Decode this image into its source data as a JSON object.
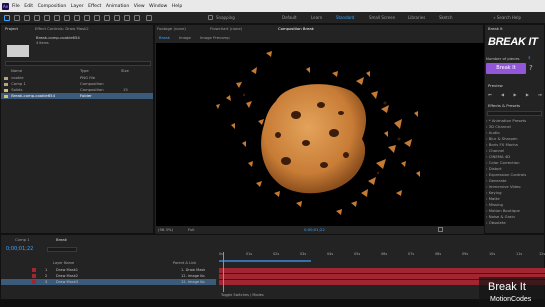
{
  "menubar": {
    "items": [
      "File",
      "Edit",
      "Composition",
      "Layer",
      "Effect",
      "Animation",
      "View",
      "Window",
      "Help"
    ]
  },
  "toolbar": {
    "snapping": "Snapping",
    "workspaces": [
      "Default",
      "Learn",
      "Standard",
      "Small Screen",
      "Libraries",
      "Sketch"
    ],
    "search_help": "Search Help"
  },
  "project": {
    "tab": "Project",
    "tab_effect_controls": "Effect Controls: Draw Mask2",
    "selected_name": "Break-comp-cookie654",
    "selected_info": "4 items",
    "headers": [
      "Name",
      "Type",
      "Size"
    ],
    "items": [
      {
        "name": "cookie",
        "type": "PNG file",
        "size": "",
        "color": "#b8a37a"
      },
      {
        "name": "Comp 1",
        "type": "Composition",
        "size": "",
        "color": "#b8a37a"
      },
      {
        "name": "Solids",
        "type": "Composition",
        "size": "15",
        "color": "#d6c06f"
      },
      {
        "name": "Break-comp-cookie654",
        "type": "Folder",
        "size": "",
        "color": "#d6c06f"
      }
    ]
  },
  "viewer": {
    "tab_footage": "Footage (none)",
    "tab_composition": "Composition Break",
    "tab_flowchart": "Flowchart (none)",
    "sub_tabs": [
      "Break",
      "Image",
      "Image Precomp"
    ],
    "zoom": "(56.3%)",
    "quality": "Full",
    "timecode": "0;00;01;22"
  },
  "break_it": {
    "panel_title": "Break It",
    "logo": "BREAK IT",
    "pieces_label": "Number of pieces",
    "pieces_value": "3",
    "button_label": "Break It",
    "help_glyph": "?"
  },
  "preview": {
    "title": "Preview"
  },
  "effects": {
    "title": "Effects & Presets",
    "items": [
      "* Animation Presets",
      "3D Channel",
      "Audio",
      "Blur & Sharpen",
      "Boris FX Mocha",
      "Channel",
      "CINEMA 4D",
      "Color Correction",
      "Distort",
      "Expression Controls",
      "Generate",
      "Immersive Video",
      "Keying",
      "Matte",
      "Missing",
      "Motion Boutique",
      "Noise & Grain",
      "Obsolete"
    ]
  },
  "timeline": {
    "tabs": [
      "Comp 1",
      "Break"
    ],
    "timecode": "0;00;01;22",
    "col_headers": [
      "Layer Name",
      "Parent & Link"
    ],
    "layers": [
      {
        "num": "1",
        "name": "Draw Mask1",
        "parent": "1. Draw Mask"
      },
      {
        "num": "2",
        "name": "Draw Mask2",
        "parent": "12. Image Ko"
      },
      {
        "num": "3",
        "name": "Draw Mask3",
        "parent": "12. Image Ko"
      }
    ],
    "ruler": [
      "0s",
      "01s",
      "02s",
      "03s",
      "04s",
      "05s",
      "06s",
      "07s",
      "08s",
      "09s",
      "10s",
      "11s",
      "12s"
    ],
    "footer": "Toggle Switches / Modes"
  },
  "watermark": {
    "line1": "Break It",
    "line2": "MotionCodes"
  }
}
